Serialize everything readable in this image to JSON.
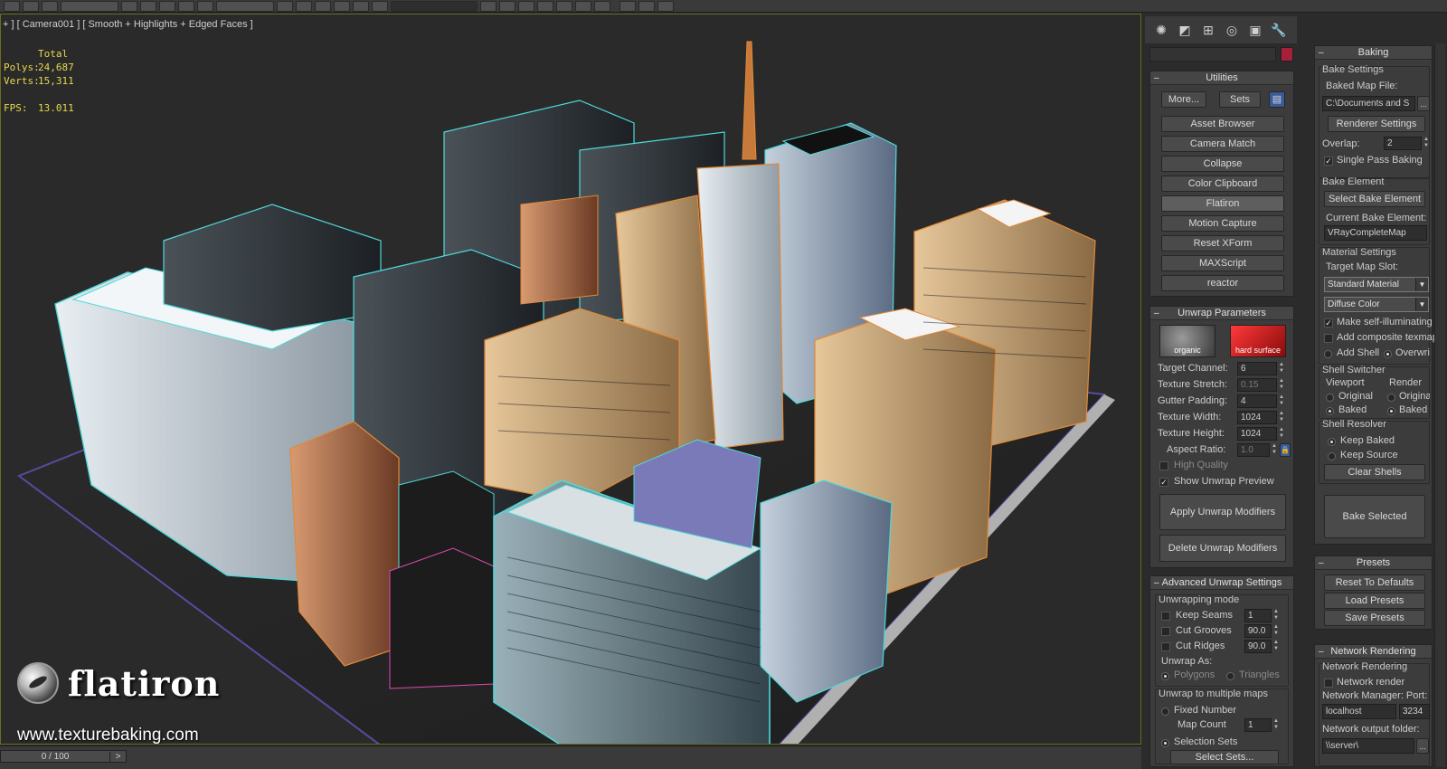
{
  "viewport": {
    "label": "+ ] [ Camera001 ] [ Smooth + Highlights + Edged Faces ]",
    "stats": {
      "total_label": "Total",
      "polys_label": "Polys:",
      "polys_value": "24,687",
      "verts_label": "Verts:",
      "verts_value": "15,311",
      "fps_label": "FPS:",
      "fps_value": "13.011"
    },
    "logo_name": "flatiron",
    "logo_url": "www.texturebaking.com"
  },
  "timeslider": {
    "value": "0 / 100",
    "next": ">"
  },
  "colors": {
    "accent_red": "#a81f3a",
    "stats_yellow": "#e6d84a",
    "wire_cyan": "#4fd8d8",
    "wire_orange": "#e08a3a"
  },
  "utilities": {
    "title": "Utilities",
    "more": "More...",
    "sets": "Sets",
    "buttons": [
      "Asset Browser",
      "Camera Match",
      "Collapse",
      "Color Clipboard",
      "Flatiron",
      "Motion Capture",
      "Reset XForm",
      "MAXScript",
      "reactor"
    ]
  },
  "unwrap": {
    "title": "Unwrap Parameters",
    "thumb_organic": "organic",
    "thumb_hard": "hard surface",
    "target_channel_label": "Target Channel:",
    "target_channel": "6",
    "texture_stretch_label": "Texture Stretch:",
    "texture_stretch": "0.15",
    "gutter_padding_label": "Gutter Padding:",
    "gutter_padding": "4",
    "texture_width_label": "Texture Width:",
    "texture_width": "1024",
    "texture_height_label": "Texture Height:",
    "texture_height": "1024",
    "aspect_ratio_label": "Aspect Ratio:",
    "aspect_ratio": "1.0",
    "high_quality": "High Quality",
    "show_preview": "Show Unwrap Preview",
    "apply": "Apply Unwrap Modifiers",
    "delete": "Delete Unwrap Modifiers"
  },
  "advanced": {
    "title": "Advanced Unwrap Settings",
    "mode_label": "Unwrapping mode",
    "keep_seams": "Keep Seams",
    "keep_seams_val": "1",
    "cut_grooves": "Cut Grooves",
    "cut_grooves_val": "90.0",
    "cut_ridges": "Cut Ridges",
    "cut_ridges_val": "90.0",
    "unwrap_as": "Unwrap As:",
    "polygons": "Polygons",
    "triangles": "Triangles",
    "multi_label": "Unwrap to multiple maps",
    "fixed_number": "Fixed Number",
    "map_count": "Map Count",
    "map_count_val": "1",
    "selection_sets": "Selection Sets",
    "select_sets": "Select Sets..."
  },
  "baking": {
    "title": "Baking",
    "bake_settings": "Bake Settings",
    "baked_map_file": "Baked Map File:",
    "file_path": "C:\\Documents and S",
    "browse": "...",
    "renderer_settings": "Renderer Settings",
    "overlap_label": "Overlap:",
    "overlap": "2",
    "single_pass": "Single Pass Baking",
    "bake_element": "Bake Element",
    "select_bake_element": "Select Bake Element",
    "current_bake_element": "Current Bake Element:",
    "current_element_value": "VRayCompleteMap",
    "material_settings": "Material Settings",
    "target_map_slot": "Target Map Slot:",
    "material_select": "Standard Material",
    "color_select": "Diffuse Color",
    "make_self_illum": "Make self-illuminating",
    "add_composite": "Add composite texmap",
    "add_shell": "Add Shell",
    "overwrite": "Overwrite",
    "shell_switcher": "Shell Switcher",
    "viewport": "Viewport",
    "render": "Render",
    "original": "Original",
    "baked": "Baked",
    "shell_resolver": "Shell Resolver",
    "keep_baked": "Keep Baked",
    "keep_source": "Keep Source",
    "clear_shells": "Clear Shells",
    "bake_selected": "Bake Selected"
  },
  "presets": {
    "title": "Presets",
    "reset": "Reset To Defaults",
    "load": "Load Presets",
    "save": "Save Presets"
  },
  "network": {
    "title": "Network Rendering",
    "group": "Network Rendering",
    "network_render": "Network render",
    "manager_label": "Network Manager: Port:",
    "host": "localhost",
    "port": "3234",
    "output_label": "Network output folder:",
    "output": "\\\\server\\"
  }
}
